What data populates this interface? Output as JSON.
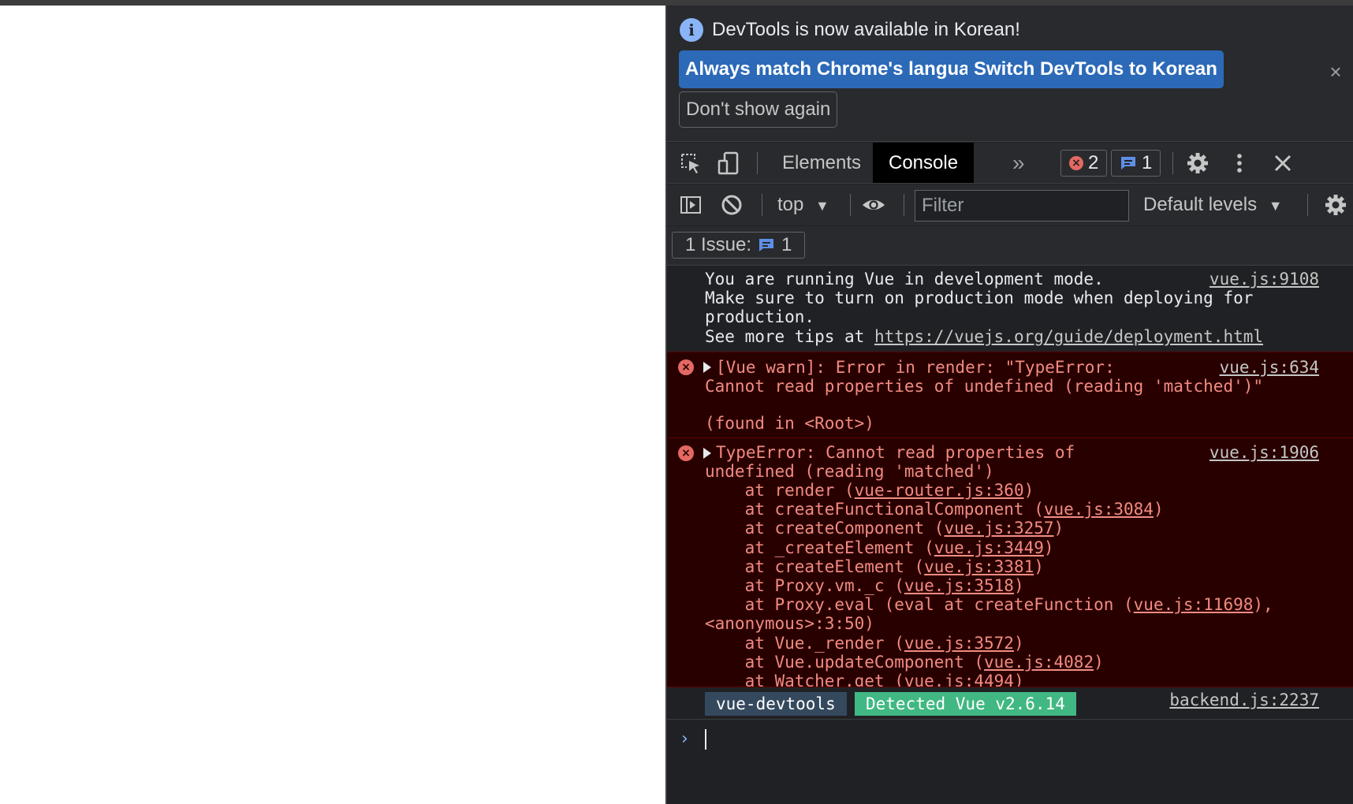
{
  "infobar": {
    "message": "DevTools is now available in Korean!",
    "match_language_label": "Always match Chrome's language",
    "switch_language_label": "Switch DevTools to Korean",
    "dont_show_label": "Don't show again",
    "close_glyph": "×",
    "info_glyph": "i"
  },
  "tabbar": {
    "tabs": [
      {
        "label": "Elements"
      },
      {
        "label": "Console"
      }
    ],
    "more_glyph": "»",
    "error_count": "2",
    "message_count": "1"
  },
  "console_toolbar": {
    "context": "top",
    "filter_placeholder": "Filter",
    "levels": "Default levels"
  },
  "issues": {
    "label": "1 Issue:",
    "count": "1"
  },
  "messages": {
    "dev_mode": {
      "line1": "You are running Vue in development mode.",
      "line2": "Make sure to turn on production mode when deploying for",
      "line3": "production.",
      "line4_prefix": "See more tips at ",
      "line4_link": "https://vuejs.org/guide/deployment.html",
      "source": "vue.js:9108"
    },
    "vue_warn": {
      "line1": "[Vue warn]: Error in render: \"TypeError:",
      "line2": "Cannot read properties of undefined (reading 'matched')\"",
      "line3": "(found in <Root>)",
      "source": "vue.js:634"
    },
    "type_error": {
      "line1": "TypeError: Cannot read properties of",
      "line2": "undefined (reading 'matched')",
      "source": "vue.js:1906",
      "stack": [
        {
          "prefix": "    at render (",
          "link": "vue-router.js:360",
          "suffix": ")"
        },
        {
          "prefix": "    at createFunctionalComponent (",
          "link": "vue.js:3084",
          "suffix": ")"
        },
        {
          "prefix": "    at createComponent (",
          "link": "vue.js:3257",
          "suffix": ")"
        },
        {
          "prefix": "    at _createElement (",
          "link": "vue.js:3449",
          "suffix": ")"
        },
        {
          "prefix": "    at createElement (",
          "link": "vue.js:3381",
          "suffix": ")"
        },
        {
          "prefix": "    at Proxy.vm._c (",
          "link": "vue.js:3518",
          "suffix": ")"
        },
        {
          "prefix": "    at Proxy.eval (eval at createFunction (",
          "link": "vue.js:11698",
          "suffix": "),"
        },
        {
          "prefix": "<anonymous>:3:50)",
          "link": "",
          "suffix": ""
        },
        {
          "prefix": "    at Vue._render (",
          "link": "vue.js:3572",
          "suffix": ")"
        },
        {
          "prefix": "    at Vue.updateComponent (",
          "link": "vue.js:4082",
          "suffix": ")"
        },
        {
          "prefix": "    at Watcher.get (",
          "link": "vue.js:4494",
          "suffix": ")"
        }
      ]
    },
    "devtools_badge": {
      "name": "vue-devtools",
      "version": "Detected Vue v2.6.14",
      "source": "backend.js:2237"
    }
  },
  "colors": {
    "accent": "#2c6ab8",
    "error_text": "#f28b82",
    "error_bg": "#290000",
    "vue_green": "#41b883",
    "vue_navy": "#35495e"
  }
}
